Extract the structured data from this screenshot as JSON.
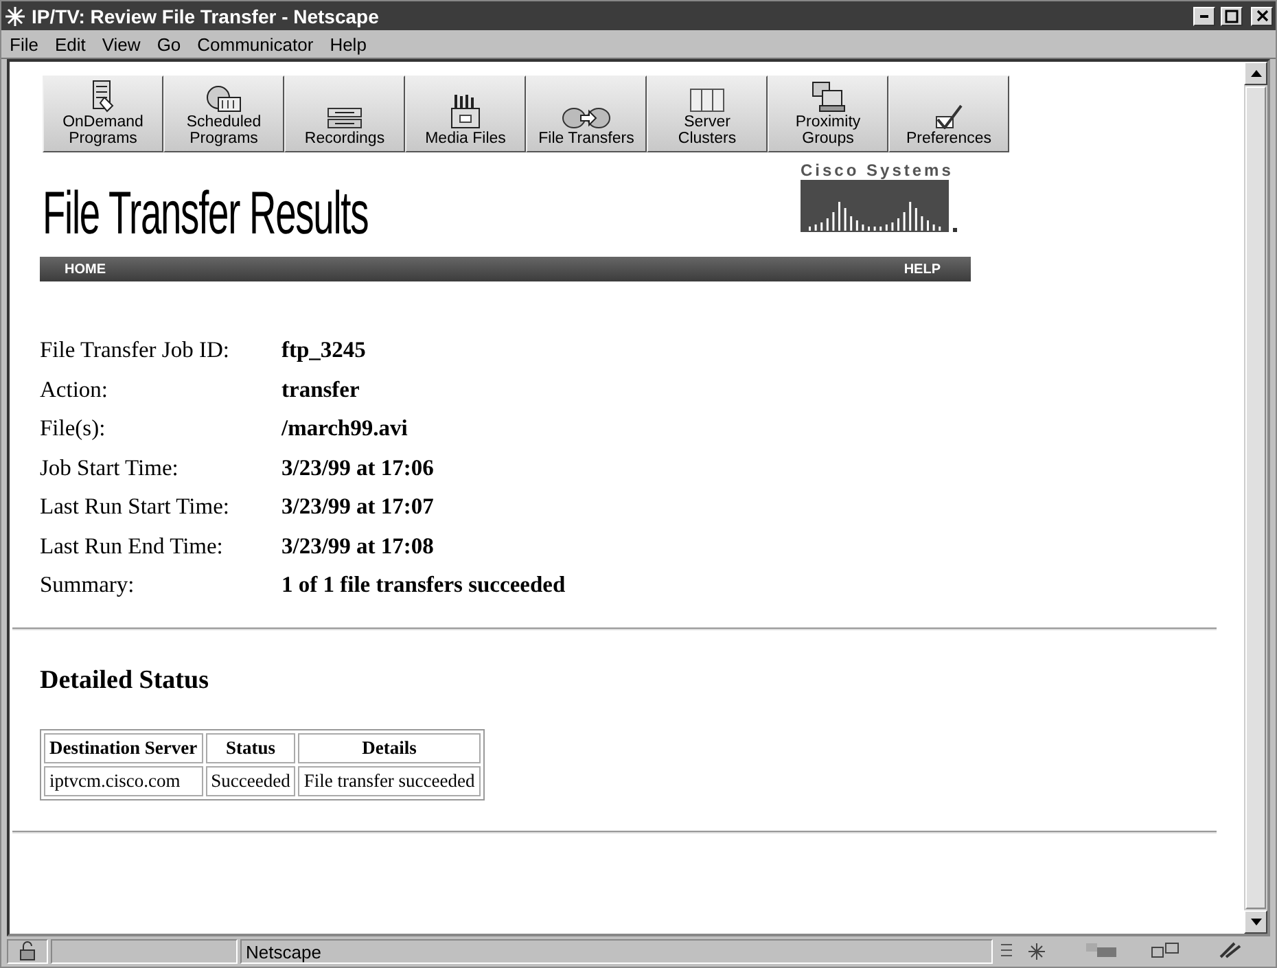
{
  "window": {
    "title": "IP/TV: Review File Transfer - Netscape"
  },
  "menu": [
    "File",
    "Edit",
    "View",
    "Go",
    "Communicator",
    "Help"
  ],
  "toolbar": [
    {
      "kind": "ondemand",
      "lines": [
        "OnDemand",
        "Programs"
      ]
    },
    {
      "kind": "scheduled",
      "lines": [
        "Scheduled",
        "Programs"
      ]
    },
    {
      "kind": "recordings",
      "lines": [
        "Recordings"
      ]
    },
    {
      "kind": "media",
      "lines": [
        "Media Files"
      ]
    },
    {
      "kind": "transfers",
      "lines": [
        "File Transfers"
      ]
    },
    {
      "kind": "servers",
      "lines": [
        "Server",
        "Clusters"
      ]
    },
    {
      "kind": "proximity",
      "lines": [
        "Proximity",
        "Groups"
      ]
    },
    {
      "kind": "preferences",
      "lines": [
        "Preferences"
      ]
    }
  ],
  "page_title": "File Transfer Results",
  "logo": {
    "text": "Cisco Systems"
  },
  "nav": {
    "left": "HOME",
    "right": "HELP"
  },
  "fields": [
    {
      "label": "File Transfer Job ID:",
      "value": "ftp_3245"
    },
    {
      "label": "Action:",
      "value": "transfer"
    },
    {
      "label": "File(s):",
      "value": "/march99.avi"
    },
    {
      "label": "Job Start Time:",
      "value": "3/23/99 at 17:06"
    },
    {
      "label": "Last Run Start Time:",
      "value": "3/23/99 at 17:07"
    },
    {
      "label": "Last Run End Time:",
      "value": "3/23/99 at 17:08"
    },
    {
      "label": "Summary:",
      "value": "1 of 1 file transfers succeeded"
    }
  ],
  "section_title": "Detailed Status",
  "table": {
    "columns": [
      "Destination Server",
      "Status",
      "Details"
    ],
    "rows": [
      [
        "iptvcm.cisco.com",
        "Succeeded",
        "File transfer succeeded"
      ]
    ]
  },
  "status_bar": {
    "text": "Netscape"
  }
}
